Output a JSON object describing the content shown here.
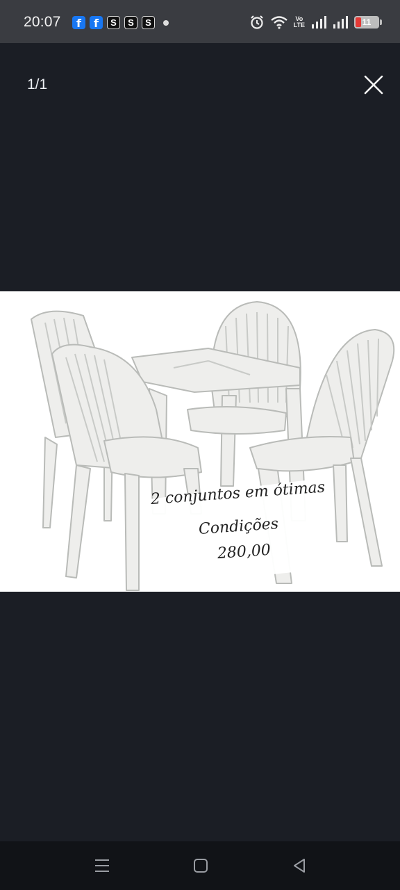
{
  "status_bar": {
    "time": "20:07",
    "notification_icons": [
      "facebook-icon",
      "facebook-icon",
      "s-app-icon",
      "s-app-icon",
      "s-app-icon",
      "more-dot"
    ],
    "s_label": "S",
    "fb_label": "f",
    "volte_top": "Vo",
    "volte_bottom": "LTE",
    "battery_level": "11",
    "battery_fraction": 0.11
  },
  "viewer": {
    "counter": "1/1",
    "close_icon": "close-icon"
  },
  "image": {
    "caption_line1": "2 conjuntos em ótimas",
    "caption_line2": "Condições",
    "caption_line3": "280,00"
  },
  "nav_bar": {
    "buttons": [
      "menu-icon",
      "home-icon",
      "back-icon"
    ]
  },
  "colors": {
    "background": "#1b1e25",
    "status_bar": "#3a3c41",
    "nav_bar": "#111317",
    "facebook": "#1877f2",
    "battery_low": "#e53935"
  }
}
